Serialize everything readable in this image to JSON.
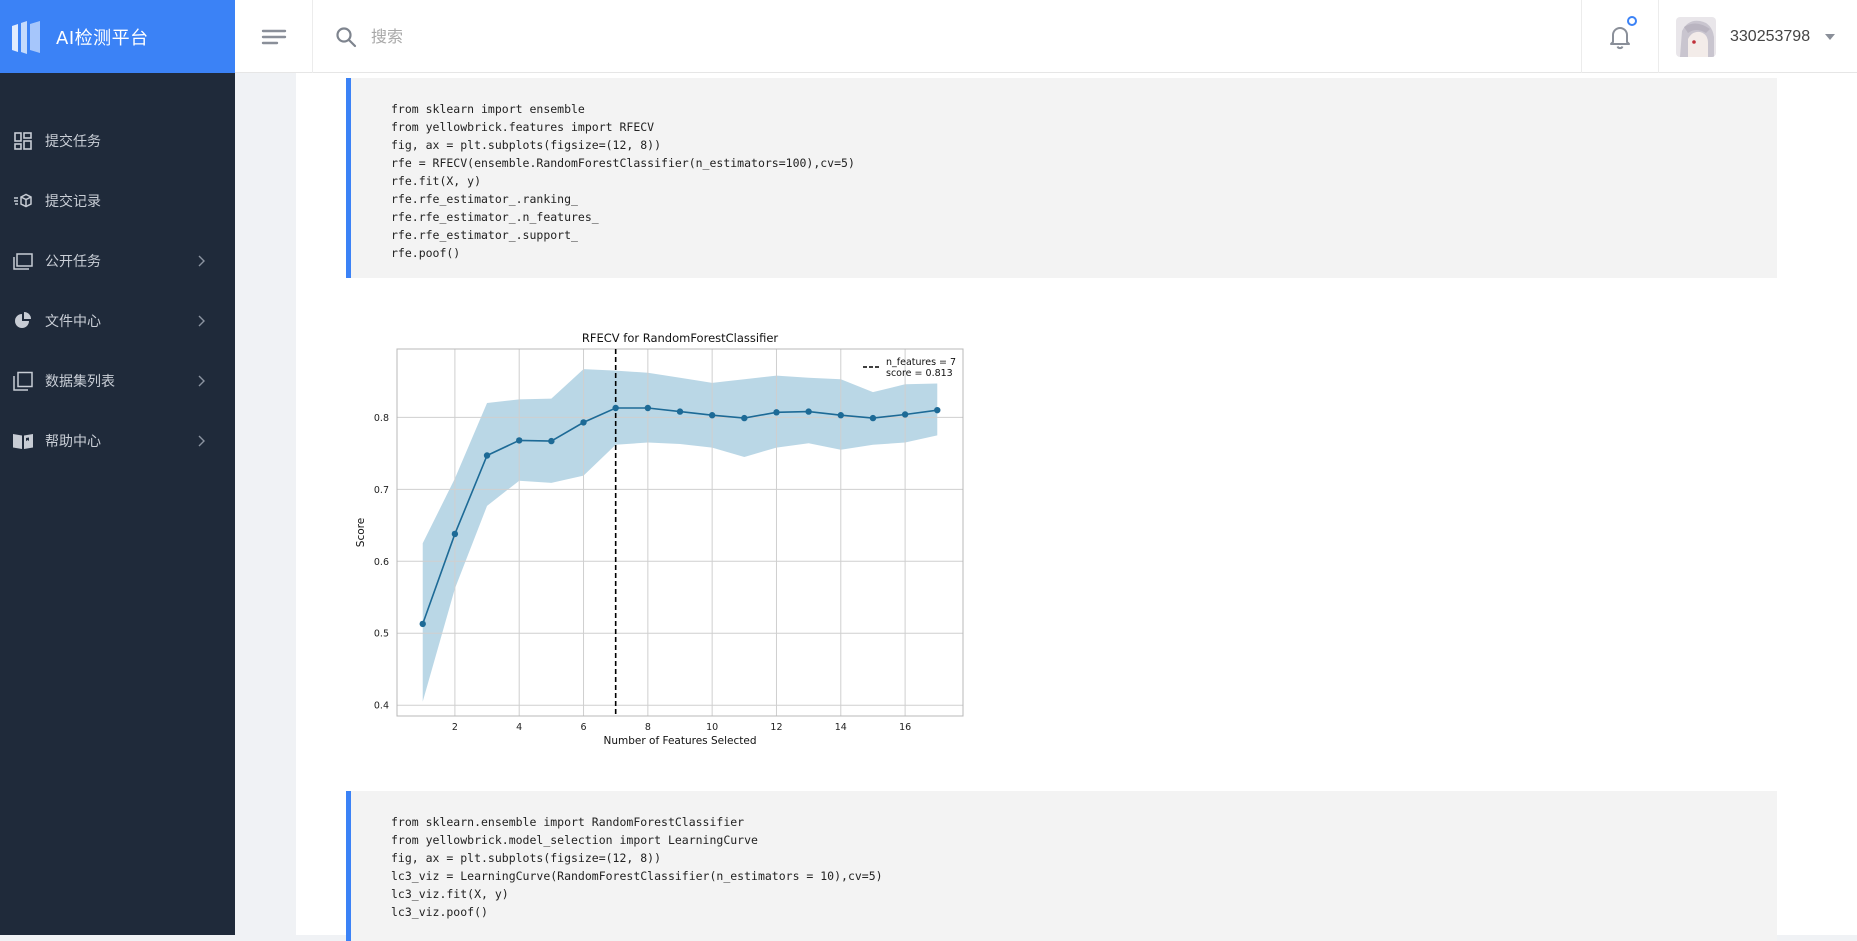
{
  "brand": {
    "title": "AI检测平台"
  },
  "sidebar": {
    "items": [
      {
        "label": "提交任务",
        "icon": "dashboard-icon",
        "has_arrow": false
      },
      {
        "label": "提交记录",
        "icon": "box-list-icon",
        "has_arrow": false
      },
      {
        "label": "公开任务",
        "icon": "folder-stack-icon",
        "has_arrow": true
      },
      {
        "label": "文件中心",
        "icon": "pie-chart-icon",
        "has_arrow": true
      },
      {
        "label": "数据集列表",
        "icon": "copy-icon",
        "has_arrow": true
      },
      {
        "label": "帮助中心",
        "icon": "book-icon",
        "has_arrow": true
      }
    ]
  },
  "header": {
    "search_placeholder": "搜索",
    "username": "330253798"
  },
  "code_blocks": [
    {
      "lines": [
        "from sklearn import ensemble",
        "from yellowbrick.features import RFECV",
        "fig, ax = plt.subplots(figsize=(12, 8))",
        "rfe = RFECV(ensemble.RandomForestClassifier(n_estimators=100),cv=5)",
        "rfe.fit(X, y)",
        "rfe.rfe_estimator_.ranking_",
        "rfe.rfe_estimator_.n_features_",
        "rfe.rfe_estimator_.support_",
        "rfe.poof()"
      ]
    },
    {
      "lines": [
        "from sklearn.ensemble import RandomForestClassifier",
        "from yellowbrick.model_selection import LearningCurve",
        "fig, ax = plt.subplots(figsize=(12, 8))",
        "lc3_viz = LearningCurve(RandomForestClassifier(n_estimators = 10),cv=5)",
        "lc3_viz.fit(X, y)",
        "lc3_viz.poof()"
      ]
    }
  ],
  "chart_data": {
    "type": "line",
    "title": "RFECV for RandomForestClassifier",
    "xlabel": "Number of Features Selected",
    "ylabel": "Score",
    "x": [
      1,
      2,
      3,
      4,
      5,
      6,
      7,
      8,
      9,
      10,
      11,
      12,
      13,
      14,
      15,
      16,
      17
    ],
    "series": [
      {
        "values": [
          0.513,
          0.638,
          0.747,
          0.768,
          0.767,
          0.793,
          0.813,
          0.813,
          0.808,
          0.803,
          0.799,
          0.807,
          0.808,
          0.803,
          0.799,
          0.804,
          0.81
        ]
      }
    ],
    "band_upper": [
      0.625,
      0.715,
      0.82,
      0.825,
      0.826,
      0.867,
      0.865,
      0.862,
      0.855,
      0.848,
      0.853,
      0.858,
      0.855,
      0.853,
      0.835,
      0.846,
      0.847
    ],
    "band_lower": [
      0.405,
      0.562,
      0.677,
      0.712,
      0.709,
      0.719,
      0.762,
      0.765,
      0.763,
      0.758,
      0.745,
      0.758,
      0.764,
      0.755,
      0.762,
      0.765,
      0.775
    ],
    "xlim": [
      0.2,
      17.8
    ],
    "ylim": [
      0.385,
      0.895
    ],
    "xticks": [
      2,
      4,
      6,
      8,
      10,
      12,
      14,
      16
    ],
    "yticks": [
      0.4,
      0.5,
      0.6,
      0.7,
      0.8
    ],
    "vline_x": 7,
    "legend": {
      "lines": [
        "n_features = 7",
        "score = 0.813"
      ],
      "placement": "top-right"
    },
    "grid": true,
    "colors": {
      "line": "#1d6a96",
      "band": "#a9cde0",
      "vline": "#000000"
    }
  }
}
